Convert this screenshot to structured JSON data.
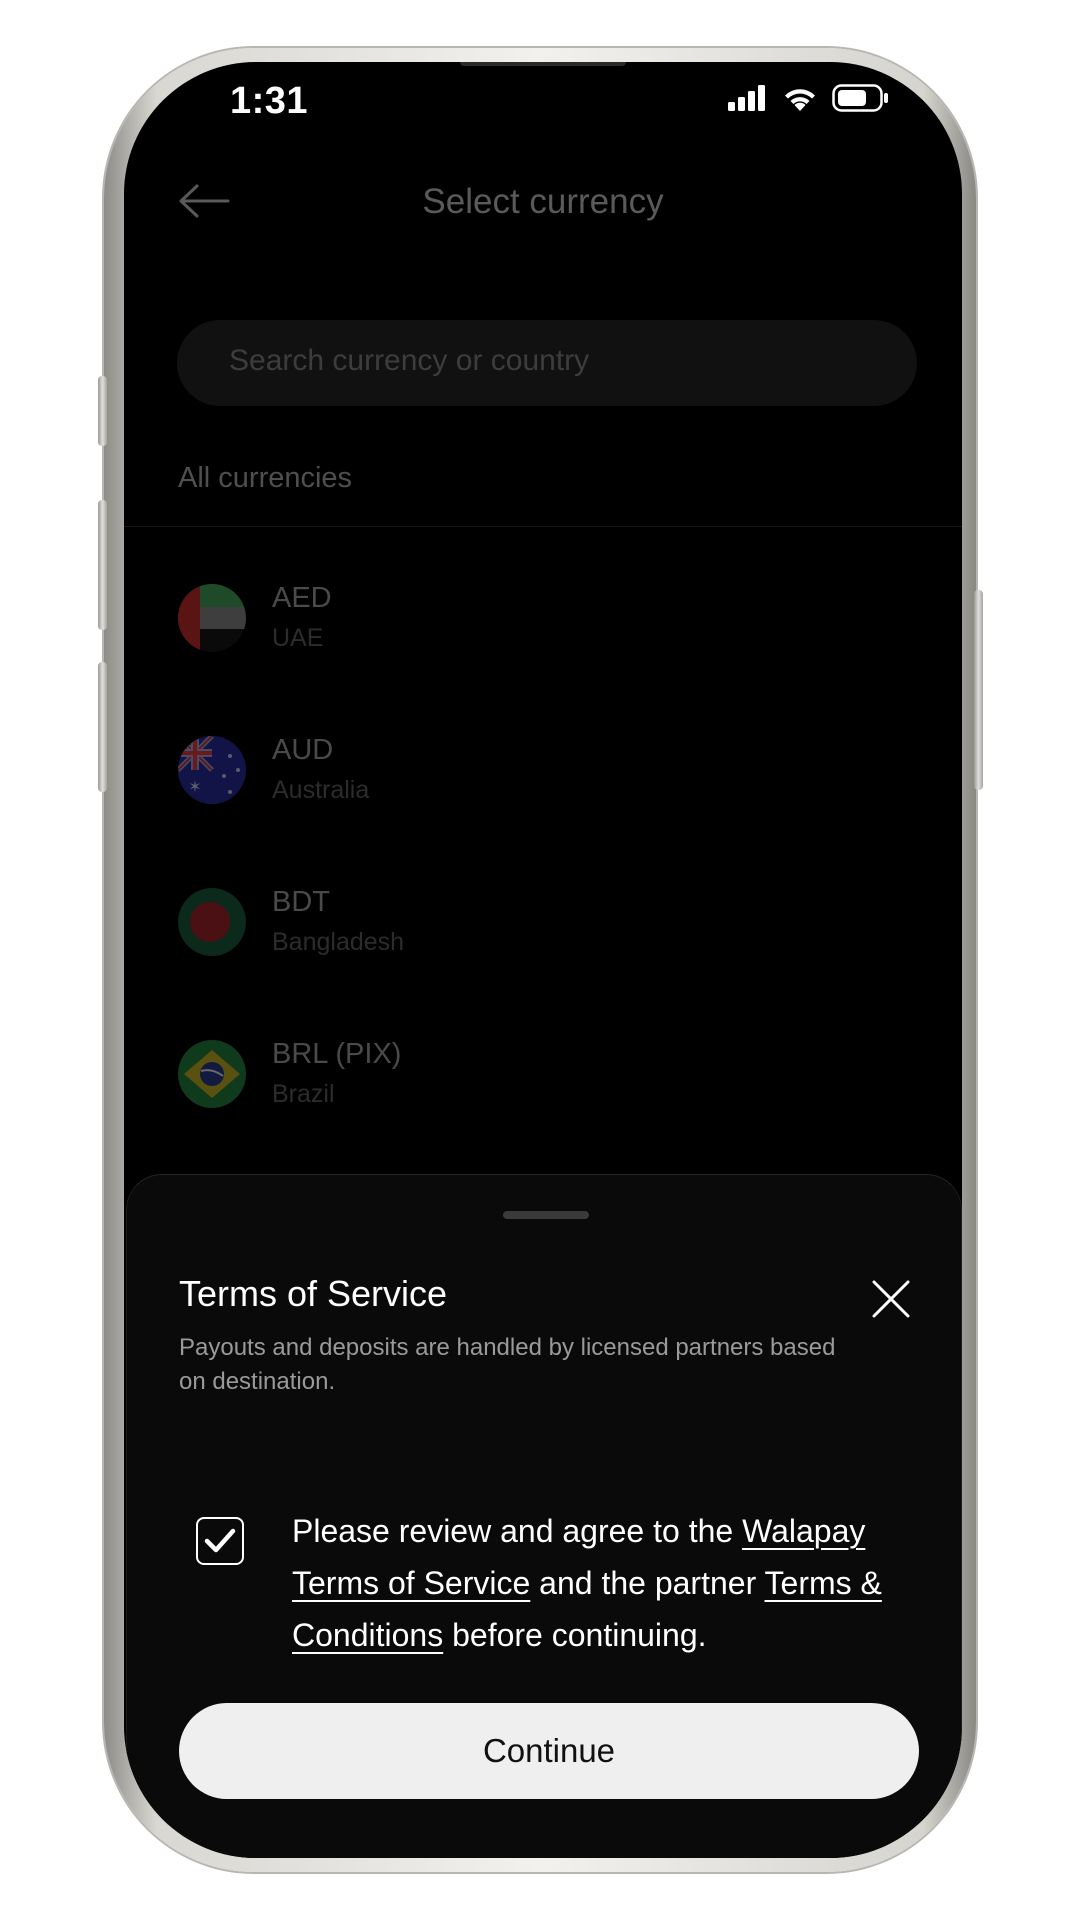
{
  "status_bar": {
    "time": "1:31"
  },
  "header": {
    "title": "Select currency",
    "back_icon": "arrow-left-icon"
  },
  "search": {
    "placeholder": "Search currency or country"
  },
  "list": {
    "section_label": "All currencies",
    "items": [
      {
        "code": "AED",
        "country": "UAE",
        "flag": "uae-flag-icon"
      },
      {
        "code": "AUD",
        "country": "Australia",
        "flag": "australia-flag-icon"
      },
      {
        "code": "BDT",
        "country": "Bangladesh",
        "flag": "bangladesh-flag-icon"
      },
      {
        "code": "BRL (PIX)",
        "country": "Brazil",
        "flag": "brazil-flag-icon"
      }
    ]
  },
  "sheet": {
    "title": "Terms of Service",
    "subtitle": "Payouts and deposits are handled by licensed partners based on destination.",
    "agreement": {
      "checked": true,
      "text_1": "Please review and agree to the ",
      "link_1": "Walapay Terms of Service",
      "text_2": " and the partner ",
      "link_2": "Terms & Conditions",
      "text_3": " before continuing."
    },
    "continue_label": "Continue"
  },
  "colors": {
    "background": "#000000",
    "sheet": "#0a0a0a",
    "button": "#efefef",
    "button_text": "#111111"
  }
}
